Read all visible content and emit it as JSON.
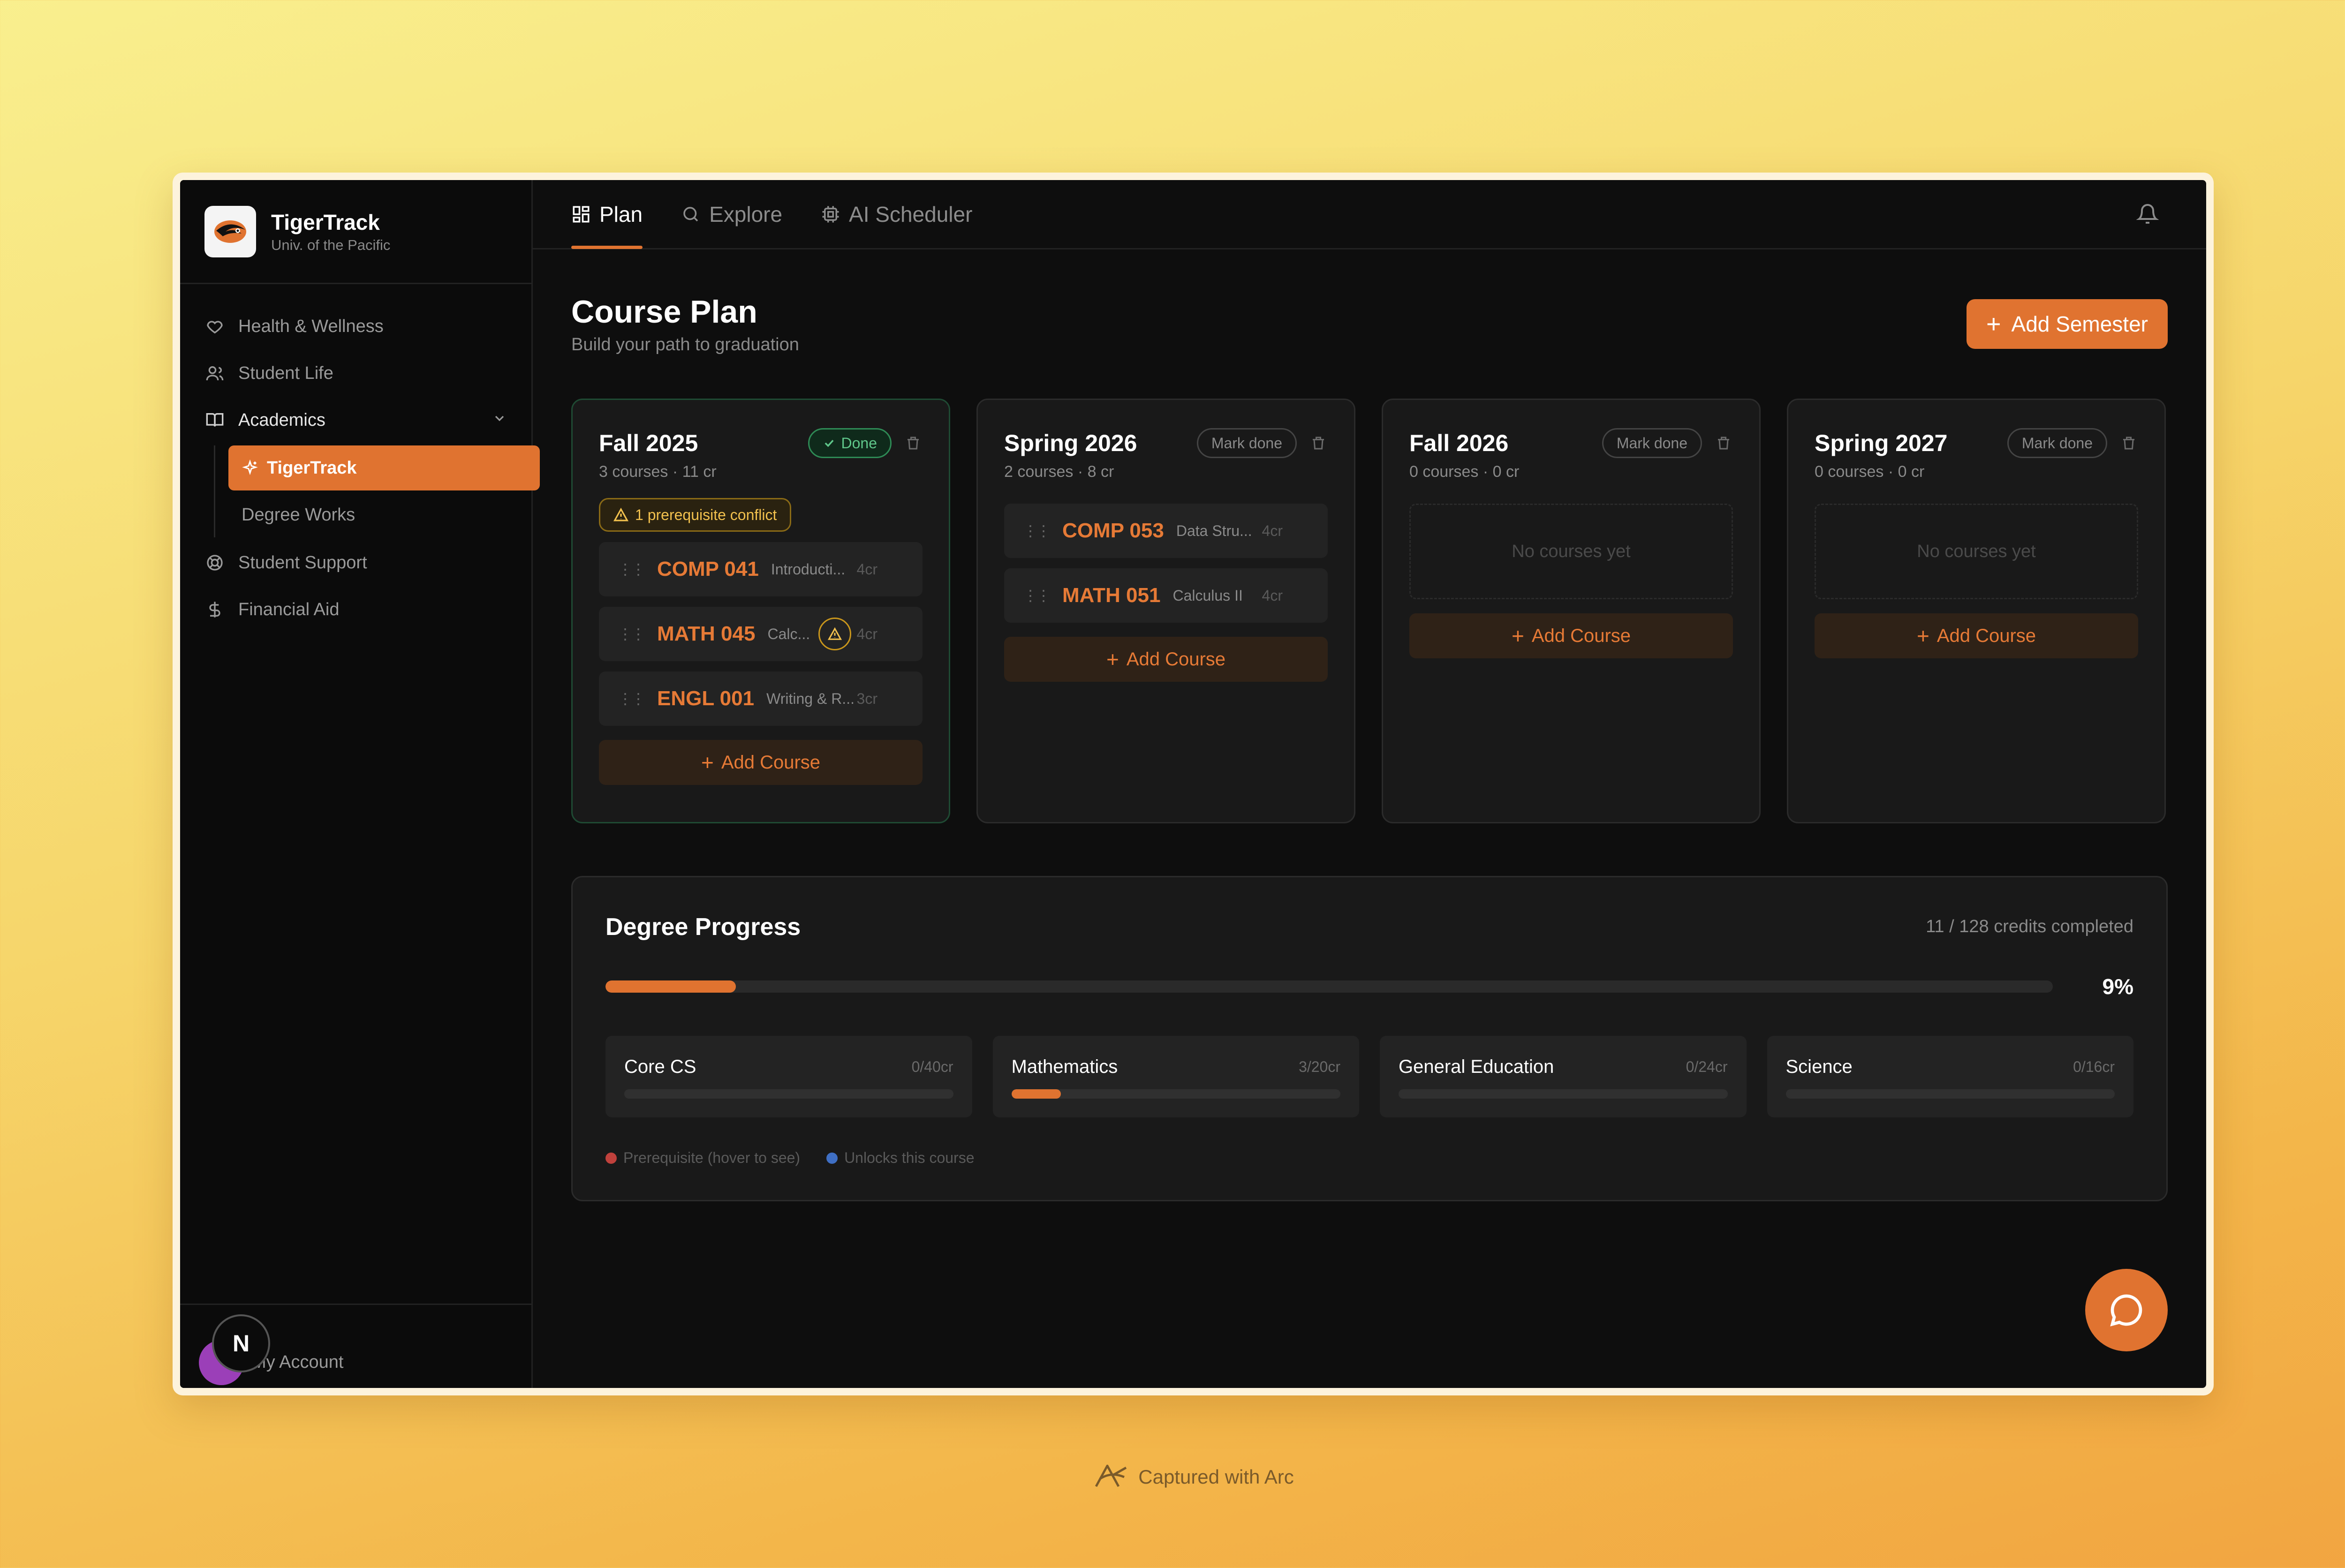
{
  "brand": {
    "name": "TigerTrack",
    "subtitle": "Univ. of the Pacific"
  },
  "sidebar": {
    "items": [
      {
        "label": "Health & Wellness",
        "icon": "heart-icon"
      },
      {
        "label": "Student Life",
        "icon": "users-icon"
      },
      {
        "label": "Academics",
        "icon": "book-icon"
      },
      {
        "label": "Student Support",
        "icon": "lifebuoy-icon"
      },
      {
        "label": "Financial Aid",
        "icon": "dollar-icon"
      }
    ],
    "academics_sub": [
      {
        "label": "TigerTrack",
        "active": true,
        "icon": "sparkles-icon"
      },
      {
        "label": "Degree Works",
        "active": false
      }
    ],
    "account": {
      "label": "My Account",
      "badge": "N",
      "avatar_color": "#9b3fb8"
    }
  },
  "tabs": [
    {
      "label": "Plan",
      "icon": "layout-icon",
      "active": true
    },
    {
      "label": "Explore",
      "icon": "search-icon",
      "active": false
    },
    {
      "label": "AI Scheduler",
      "icon": "cpu-icon",
      "active": false
    }
  ],
  "page": {
    "title": "Course Plan",
    "subtitle": "Build your path to graduation",
    "add_semester": "Add Semester"
  },
  "semesters": [
    {
      "title": "Fall 2025",
      "meta": "3 courses · 11 cr",
      "status": "Done",
      "conflict": "1 prerequisite conflict",
      "courses": [
        {
          "code": "COMP 041",
          "name": "Introducti...",
          "credits": "4cr"
        },
        {
          "code": "MATH 045",
          "name": "Calc...",
          "credits": "4cr",
          "warning": true
        },
        {
          "code": "ENGL 001",
          "name": "Writing & R...",
          "credits": "3cr"
        }
      ],
      "add_label": "Add Course"
    },
    {
      "title": "Spring 2026",
      "meta": "2 courses · 8 cr",
      "status": "Mark done",
      "courses": [
        {
          "code": "COMP 053",
          "name": "Data Stru...",
          "credits": "4cr"
        },
        {
          "code": "MATH 051",
          "name": "Calculus II",
          "credits": "4cr"
        }
      ],
      "add_label": "Add Course"
    },
    {
      "title": "Fall 2026",
      "meta": "0 courses · 0 cr",
      "status": "Mark done",
      "empty": "No courses yet",
      "add_label": "Add Course"
    },
    {
      "title": "Spring 2027",
      "meta": "0 courses · 0 cr",
      "status": "Mark done",
      "empty": "No courses yet",
      "add_label": "Add Course"
    }
  ],
  "progress": {
    "title": "Degree Progress",
    "credits_text": "11 / 128 credits completed",
    "percent_label": "9%",
    "percent_value": 0.09,
    "categories": [
      {
        "name": "Core CS",
        "credits": "0/40cr",
        "fraction": 0
      },
      {
        "name": "Mathematics",
        "credits": "3/20cr",
        "fraction": 0.15
      },
      {
        "name": "General Education",
        "credits": "0/24cr",
        "fraction": 0
      },
      {
        "name": "Science",
        "credits": "0/16cr",
        "fraction": 0
      }
    ],
    "legend": [
      {
        "label": "Prerequisite (hover to see)",
        "color": "#c0413c"
      },
      {
        "label": "Unlocks this course",
        "color": "#3f6fc4"
      }
    ]
  },
  "footer": {
    "captured": "Captured with Arc"
  },
  "colors": {
    "accent": "#e07330",
    "done_green": "#5fc68a",
    "warning": "#f2c14e"
  }
}
